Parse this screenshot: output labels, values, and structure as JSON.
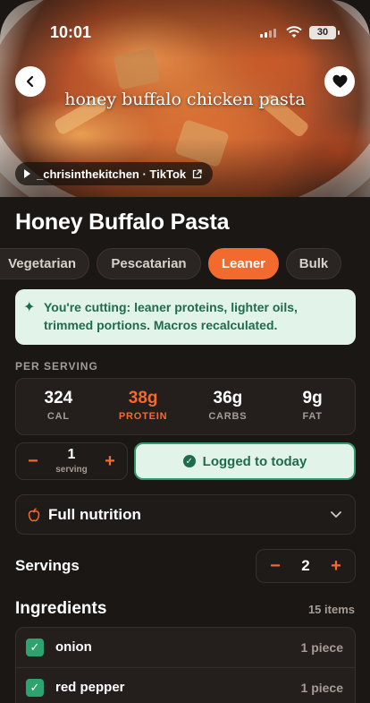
{
  "status_bar": {
    "time": "10:01",
    "battery": "30"
  },
  "hero": {
    "overlay_text": "honey buffalo chicken pasta",
    "source": "_chrisinthekitchen · TikTok",
    "back_icon": "chevron-left-icon",
    "favorite_icon": "heart-icon"
  },
  "recipe": {
    "title": "Honey Buffalo Pasta"
  },
  "diet_chips": [
    {
      "label": "Vegetarian",
      "active": false
    },
    {
      "label": "Pescatarian",
      "active": false
    },
    {
      "label": "Leaner",
      "active": true
    },
    {
      "label": "Bulk",
      "active": false
    }
  ],
  "notice": {
    "text": "You're cutting: leaner proteins, lighter oils, trimmed portions. Macros recalculated."
  },
  "per_serving": {
    "label": "PER SERVING",
    "macros": [
      {
        "value": "324",
        "label": "CAL"
      },
      {
        "value": "38g",
        "label": "PROTEIN"
      },
      {
        "value": "36g",
        "label": "CARBS"
      },
      {
        "value": "9g",
        "label": "FAT"
      }
    ]
  },
  "log": {
    "minus": "−",
    "plus": "+",
    "count": "1",
    "unit": "serving",
    "button_label": "Logged to today"
  },
  "full_nutrition": {
    "label": "Full nutrition"
  },
  "servings": {
    "label": "Servings",
    "minus": "−",
    "plus": "+",
    "value": "2"
  },
  "ingredients": {
    "title": "Ingredients",
    "count": "15 items",
    "items": [
      {
        "name": "onion",
        "qty": "1 piece",
        "checked": true
      },
      {
        "name": "red pepper",
        "qty": "1 piece",
        "checked": true
      }
    ]
  },
  "colors": {
    "accent": "#f26a2e",
    "success": "#2ea36f",
    "notice_bg": "#e2f3ea",
    "background": "#1b1715"
  }
}
